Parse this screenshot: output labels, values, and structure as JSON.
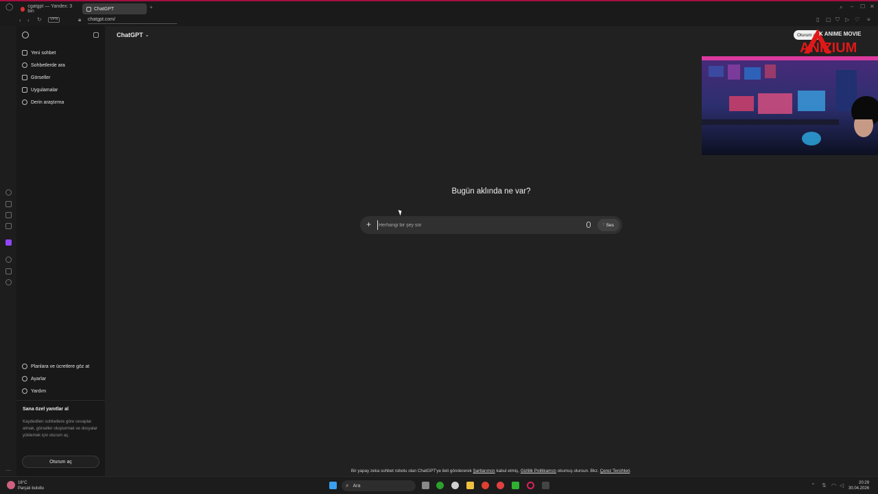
{
  "browser": {
    "tabs": [
      {
        "label": "cgatgpt — Yandex: 3 bin"
      },
      {
        "label": "ChatGPT"
      }
    ],
    "vpn_label": "VPN",
    "url": "chatgpt.com/"
  },
  "sidebar": {
    "items": [
      {
        "label": "Yeni sohbet",
        "icon": "edit-icon"
      },
      {
        "label": "Sohbetlerde ara",
        "icon": "search-icon"
      },
      {
        "label": "Görseller",
        "icon": "image-icon"
      },
      {
        "label": "Uygulamalar",
        "icon": "apps-icon"
      },
      {
        "label": "Derin araştırma",
        "icon": "telescope-icon"
      }
    ],
    "bottom_items": [
      {
        "label": "Planlara ve ücretlere göz at",
        "icon": "plans-icon"
      },
      {
        "label": "Ayarlar",
        "icon": "gear-icon"
      },
      {
        "label": "Yardım",
        "icon": "help-icon"
      }
    ],
    "promo": {
      "title": "Sana özel yanıtlar al",
      "text": "Kaydedilen sohbetlere göre cevaplar almak, görseller oluşturmak ve dosyalar yüklemek için oturum aç."
    },
    "login_button": "Oturum aç"
  },
  "header": {
    "model_label": "ChatGPT",
    "login_pill": "Oturum aç"
  },
  "main": {
    "hero": "Bugün aklında ne var?",
    "composer": {
      "placeholder": "Herhangi bir şey sor",
      "voice_label": "Ses"
    }
  },
  "footer": {
    "prefix": "Bir yapay zeka sohbet robotu olan ChatGPT'ye ileti göndererek ",
    "terms": "Şartlarımızı",
    "middle": " kabul etmiş, ",
    "privacy": "Gizlilik Politikamızı",
    "suffix": " okumuş olursun. Bkz. ",
    "cookies": "Çerez Tercihleri",
    "end": "."
  },
  "overlay": {
    "logo_text": "ANIZIUM",
    "logo_sub": "K ANIME MOVIE"
  },
  "taskbar": {
    "search_label": "Ara",
    "weather_temp": "18°C",
    "weather_desc": "Parçalı bulutlu",
    "time": "20:29",
    "date": "30.04.2026"
  }
}
